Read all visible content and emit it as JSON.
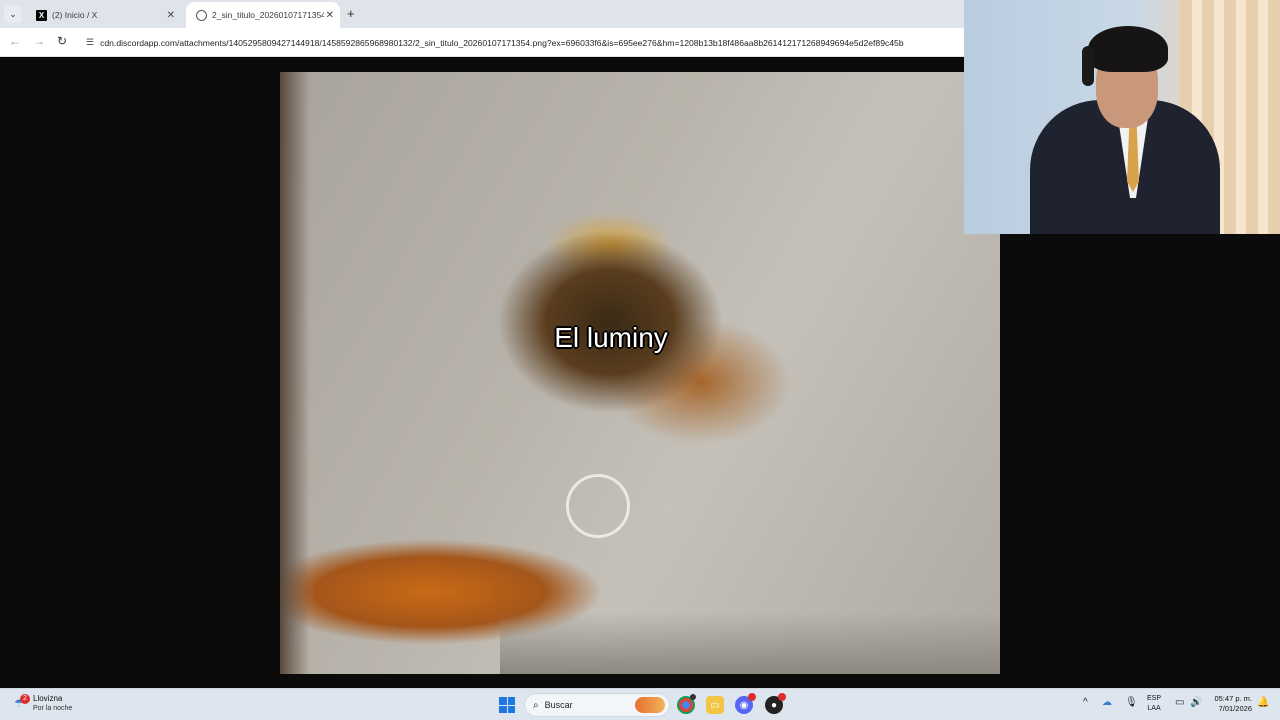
{
  "browser": {
    "tabs": [
      {
        "label": "(2) Inicio / X",
        "icon": "x-logo-icon",
        "active": false
      },
      {
        "label": "2_sin_titulo_20260107171354.p",
        "icon": "globe-icon",
        "active": true
      }
    ],
    "new_tab_label": "+",
    "close_label": "✕",
    "url": "cdn.discordapp.com/attachments/1405295809427144918/1458592865968980132/2_sin_titulo_20260107171354.png?ex=696033f6&is=695ee276&hm=1208b13b18f486aa8b261412171268949694e5d2ef89c45b"
  },
  "image": {
    "caption": "El luminy"
  },
  "taskbar": {
    "weather": {
      "badge": "2",
      "condition": "Llovizna",
      "detail": "Por la noche"
    },
    "search_placeholder": "Buscar",
    "language": {
      "line1": "ESP",
      "line2": "LAA"
    },
    "clock": {
      "time": "05:47 p. m.",
      "date": "7/01/2026"
    },
    "apps": [
      "chrome-icon",
      "file-explorer-icon",
      "discord-icon",
      "obs-icon"
    ]
  },
  "colors": {
    "accent": "#1f78e0",
    "badge": "#e02b2b"
  }
}
